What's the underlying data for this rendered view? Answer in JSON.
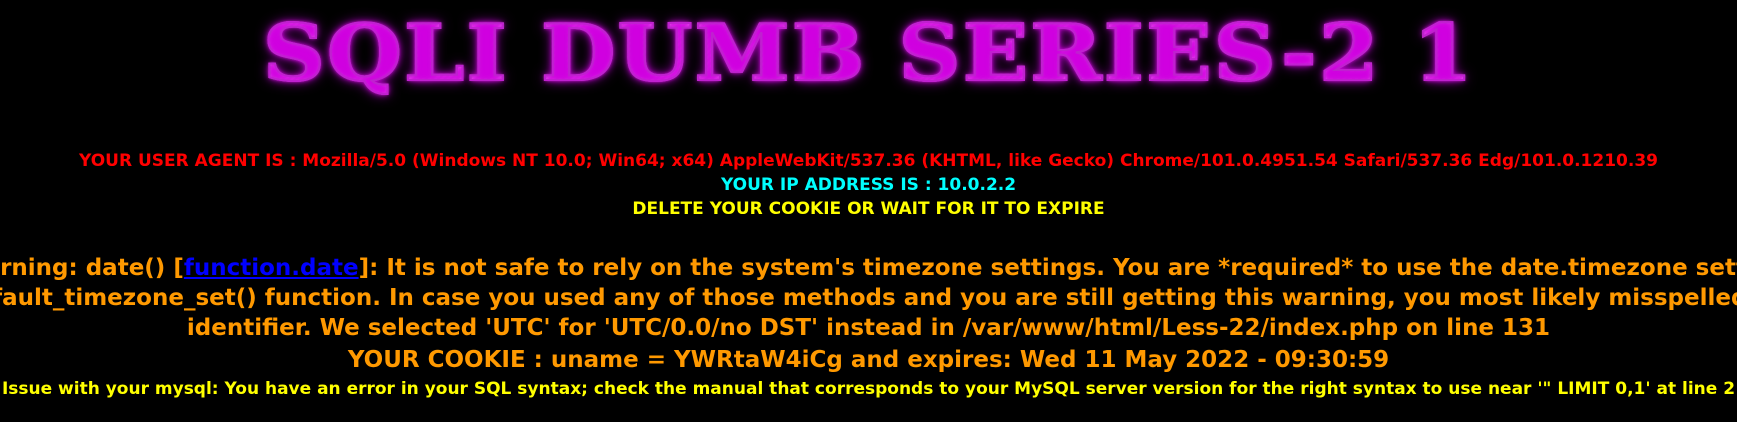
{
  "banner": {
    "title": "SQLI DUMB SERIES-2 1"
  },
  "user_agent": {
    "text": "YOUR USER AGENT IS : Mozilla/5.0 (Windows NT 10.0; Win64; x64) AppleWebKit/537.36 (KHTML, like Gecko) Chrome/101.0.4951.54 Safari/537.36 Edg/101.0.1210.39",
    "color": "#ff0000"
  },
  "ip": {
    "text": "YOUR IP ADDRESS IS : 10.0.2.2",
    "color": "#00ffff"
  },
  "cookie_note": {
    "text": "DELETE YOUR COOKIE OR WAIT FOR IT TO EXPIRE",
    "color": "#ffff00"
  },
  "warning": {
    "prefix": "Warning: date() [",
    "link_text": "function.date",
    "line1_rest": "]: It is not safe to rely on the system's timezone settings. You are *required* to use the date.timezone setting or the",
    "line2": "default_timezone_set() function. In case you used any of those methods and you are still getting this warning, you most likely misspelled the time",
    "line3": "identifier. We selected 'UTC' for 'UTC/0.0/no DST' instead in /var/www/html/Less-22/index.php on line 131",
    "color": "#ff9900",
    "link_color": "#0000ff"
  },
  "cookie": {
    "text": "YOUR COOKIE : uname = YWRtaW4iCg and expires: Wed 11 May 2022 - 09:30:59"
  },
  "mysql_error": {
    "text": "Issue with your mysql: You have an error in your SQL syntax; check the manual that corresponds to your MySQL server version for the right syntax to use near '\" LIMIT 0,1' at line 2",
    "color": "#ffff00"
  }
}
